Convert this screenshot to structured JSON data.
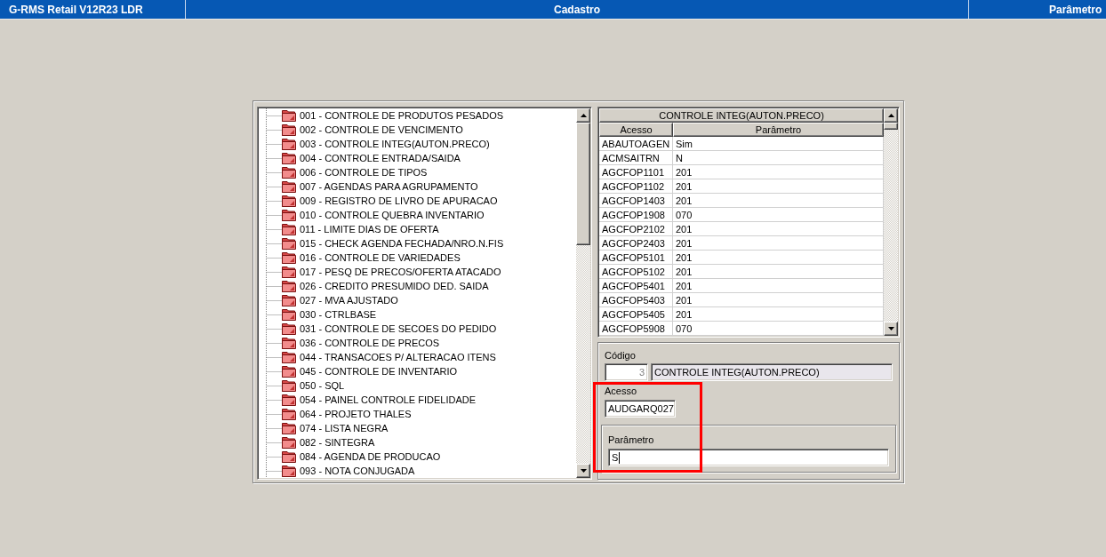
{
  "header": {
    "app_title": "G-RMS Retail V12R23 LDR",
    "section": "Cadastro",
    "subsection": "Parâmetro"
  },
  "tree": {
    "items": [
      {
        "label": "001 - CONTROLE DE PRODUTOS PESADOS",
        "selected": false
      },
      {
        "label": "002 - CONTROLE DE VENCIMENTO",
        "selected": false
      },
      {
        "label": "003 - CONTROLE INTEG(AUTON.PRECO)",
        "selected": false
      },
      {
        "label": "004 - CONTROLE ENTRADA/SAIDA",
        "selected": false
      },
      {
        "label": "006 - CONTROLE DE TIPOS",
        "selected": false
      },
      {
        "label": "007 - AGENDAS PARA AGRUPAMENTO",
        "selected": false
      },
      {
        "label": "009 - REGISTRO DE LIVRO DE APURACAO",
        "selected": false
      },
      {
        "label": "010 - CONTROLE QUEBRA INVENTARIO",
        "selected": false
      },
      {
        "label": "011 - LIMITE DIAS DE OFERTA",
        "selected": false
      },
      {
        "label": "015 - CHECK AGENDA FECHADA/NRO.N.FIS",
        "selected": false
      },
      {
        "label": "016 - CONTROLE DE VARIEDADES",
        "selected": false
      },
      {
        "label": "017 - PESQ DE PRECOS/OFERTA ATACADO",
        "selected": false
      },
      {
        "label": "026 - CREDITO PRESUMIDO DED. SAIDA",
        "selected": false
      },
      {
        "label": "027 - MVA AJUSTADO",
        "selected": false
      },
      {
        "label": "030 - CTRLBASE",
        "selected": false
      },
      {
        "label": "031 - CONTROLE DE SECOES DO PEDIDO",
        "selected": false
      },
      {
        "label": "036 - CONTROLE DE PRECOS",
        "selected": false
      },
      {
        "label": "044 - TRANSACOES P/ ALTERACAO ITENS",
        "selected": false
      },
      {
        "label": "045 - CONTROLE DE INVENTARIO",
        "selected": false
      },
      {
        "label": "050 - SQL",
        "selected": false
      },
      {
        "label": "054 - PAINEL CONTROLE FIDELIDADE",
        "selected": false
      },
      {
        "label": "064 - PROJETO THALES",
        "selected": false
      },
      {
        "label": "074 - LISTA NEGRA",
        "selected": false
      },
      {
        "label": "082 - SINTEGRA",
        "selected": false
      },
      {
        "label": "084 - AGENDA DE PRODUCAO",
        "selected": false
      },
      {
        "label": "093 - NOTA CONJUGADA",
        "selected": false
      }
    ]
  },
  "table": {
    "caption": "CONTROLE INTEG(AUTON.PRECO)",
    "columns": [
      "Acesso",
      "Parâmetro"
    ],
    "rows": [
      [
        "ABAUTOAGEN",
        "Sim"
      ],
      [
        "ACMSAITRN",
        "N"
      ],
      [
        "AGCFOP1101",
        "201"
      ],
      [
        "AGCFOP1102",
        "201"
      ],
      [
        "AGCFOP1403",
        "201"
      ],
      [
        "AGCFOP1908",
        "070"
      ],
      [
        "AGCFOP2102",
        "201"
      ],
      [
        "AGCFOP2403",
        "201"
      ],
      [
        "AGCFOP5101",
        "201"
      ],
      [
        "AGCFOP5102",
        "201"
      ],
      [
        "AGCFOP5401",
        "201"
      ],
      [
        "AGCFOP5403",
        "201"
      ],
      [
        "AGCFOP5405",
        "201"
      ],
      [
        "AGCFOP5908",
        "070"
      ]
    ]
  },
  "form": {
    "codigo": {
      "label": "Código",
      "code": {
        "value": "3",
        "disabled": true
      },
      "description": {
        "value": "CONTROLE INTEG(AUTON.PRECO)",
        "read_only": true
      }
    },
    "acesso": {
      "label": "Acesso",
      "value": "AUDGARQ027"
    },
    "parametro": {
      "label": "Parâmetro",
      "value": "S",
      "focused": true
    },
    "highlight": true
  }
}
